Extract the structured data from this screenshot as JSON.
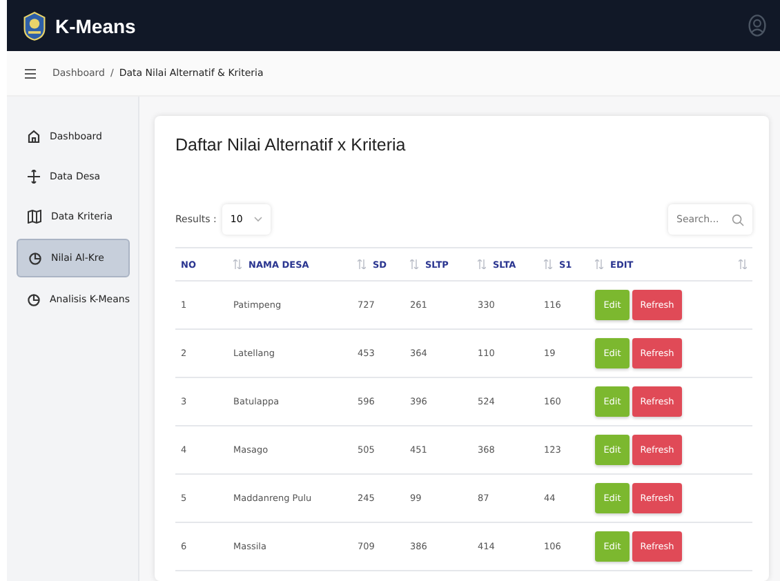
{
  "app": {
    "title": "K-Means"
  },
  "breadcrumb": {
    "parent": "Dashboard",
    "separator": "/",
    "current": "Data Nilai Alternatif & Kriteria"
  },
  "sidebar": {
    "items": [
      {
        "label": "Dashboard",
        "selected": false
      },
      {
        "label": "Data Desa",
        "selected": false
      },
      {
        "label": "Data Kriteria",
        "selected": false
      },
      {
        "label": "Nilai Al-Kre",
        "selected": true
      },
      {
        "label": "Analisis K-Means",
        "selected": false
      }
    ]
  },
  "card": {
    "title": "Daftar Nilai Alternatif x Kriteria",
    "results_label": "Results :",
    "results_value": "10",
    "search": {
      "placeholder": "Search..."
    },
    "table": {
      "columns": [
        "NO",
        "NAMA DESA",
        "SD",
        "SLTP",
        "SLTA",
        "S1",
        "EDIT"
      ],
      "rows": [
        {
          "cells": [
            "1",
            "Patimpeng",
            "727",
            "261",
            "330",
            "116"
          ],
          "actions": [
            "Edit",
            "Refresh"
          ]
        },
        {
          "cells": [
            "2",
            "Latellang",
            "453",
            "364",
            "110",
            "19"
          ],
          "actions": [
            "Edit",
            "Refresh"
          ]
        },
        {
          "cells": [
            "3",
            "Batulappa",
            "596",
            "396",
            "524",
            "160"
          ],
          "actions": [
            "Edit",
            "Refresh"
          ]
        },
        {
          "cells": [
            "4",
            "Masago",
            "505",
            "451",
            "368",
            "123"
          ],
          "actions": [
            "Edit",
            "Refresh"
          ]
        },
        {
          "cells": [
            "5",
            "Maddanreng Pulu",
            "245",
            "99",
            "87",
            "44"
          ],
          "actions": [
            "Edit",
            "Refresh"
          ]
        },
        {
          "cells": [
            "6",
            "Massila",
            "709",
            "386",
            "414",
            "106"
          ],
          "actions": [
            "Edit",
            "Refresh"
          ]
        }
      ]
    }
  }
}
